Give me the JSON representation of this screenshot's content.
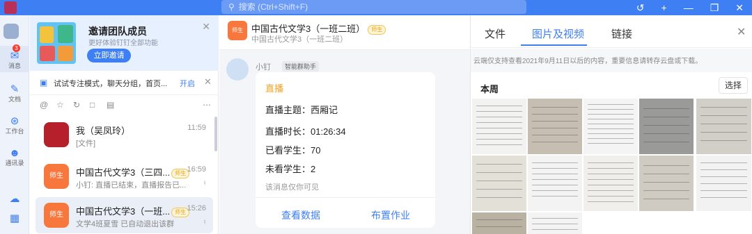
{
  "topbar": {
    "search_placeholder": "搜索 (Ctrl+Shift+F)",
    "icons": [
      "history-icon",
      "plus-icon",
      "minimize-icon",
      "restore-icon",
      "close-icon"
    ]
  },
  "rail": {
    "items": [
      {
        "name": "消息",
        "icon": "message-icon",
        "badge": "3",
        "active": true
      },
      {
        "name": "文档",
        "icon": "doc-icon"
      },
      {
        "name": "工作台",
        "icon": "workbench-icon"
      },
      {
        "name": "通讯录",
        "icon": "contacts-icon"
      }
    ]
  },
  "banner": {
    "title": "邀请团队成员",
    "subtitle": "更好体验钉钉全部功能",
    "button": "立即邀请"
  },
  "tip": {
    "text": "试试专注模式，聊天分组，首页...",
    "action": "开启"
  },
  "conversations": [
    {
      "name": "我（吴凤玲）",
      "time": "11:59",
      "preview": "[文件]",
      "tag": ""
    },
    {
      "name": "中国古代文学3（三四...",
      "time": "16:59",
      "preview": "小钉: 直播已结束，直播报告已...",
      "tag": "师生",
      "avatar": "师生"
    },
    {
      "name": "中国古代文学3（一班...",
      "time": "15:26",
      "preview": "文学4班夏雪 已自动退出该群",
      "tag": "师生",
      "avatar": "师生"
    }
  ],
  "chat": {
    "title": "中国古代文学3（一班二班）",
    "subtitle": "中国古代文学3（一班二班）",
    "tag": "师生",
    "avatar": "师生",
    "sender": "小钉",
    "bot_tag": "智能群助手",
    "card": {
      "title": "直播",
      "topic": "直播主题：西厢记",
      "duration": "直播时长：01:26:34",
      "watched": "已看学生：70",
      "unwatched": "未看学生：2",
      "note": "该消息仅你可见",
      "action_data": "查看数据",
      "action_homework": "布置作业"
    }
  },
  "side": {
    "tabs": [
      "文件",
      "图片及视频",
      "链接"
    ],
    "active_tab": 1,
    "notice": "云端仅支持查看2021年9月11日以后的内容，重要信息请转存云盘或下载。",
    "section": "本周",
    "select": "选择"
  },
  "colors": {
    "accent": "#3f7ff4",
    "live": "#f7a024",
    "group_avatar": "#f7773c",
    "badge": "#f04134"
  }
}
